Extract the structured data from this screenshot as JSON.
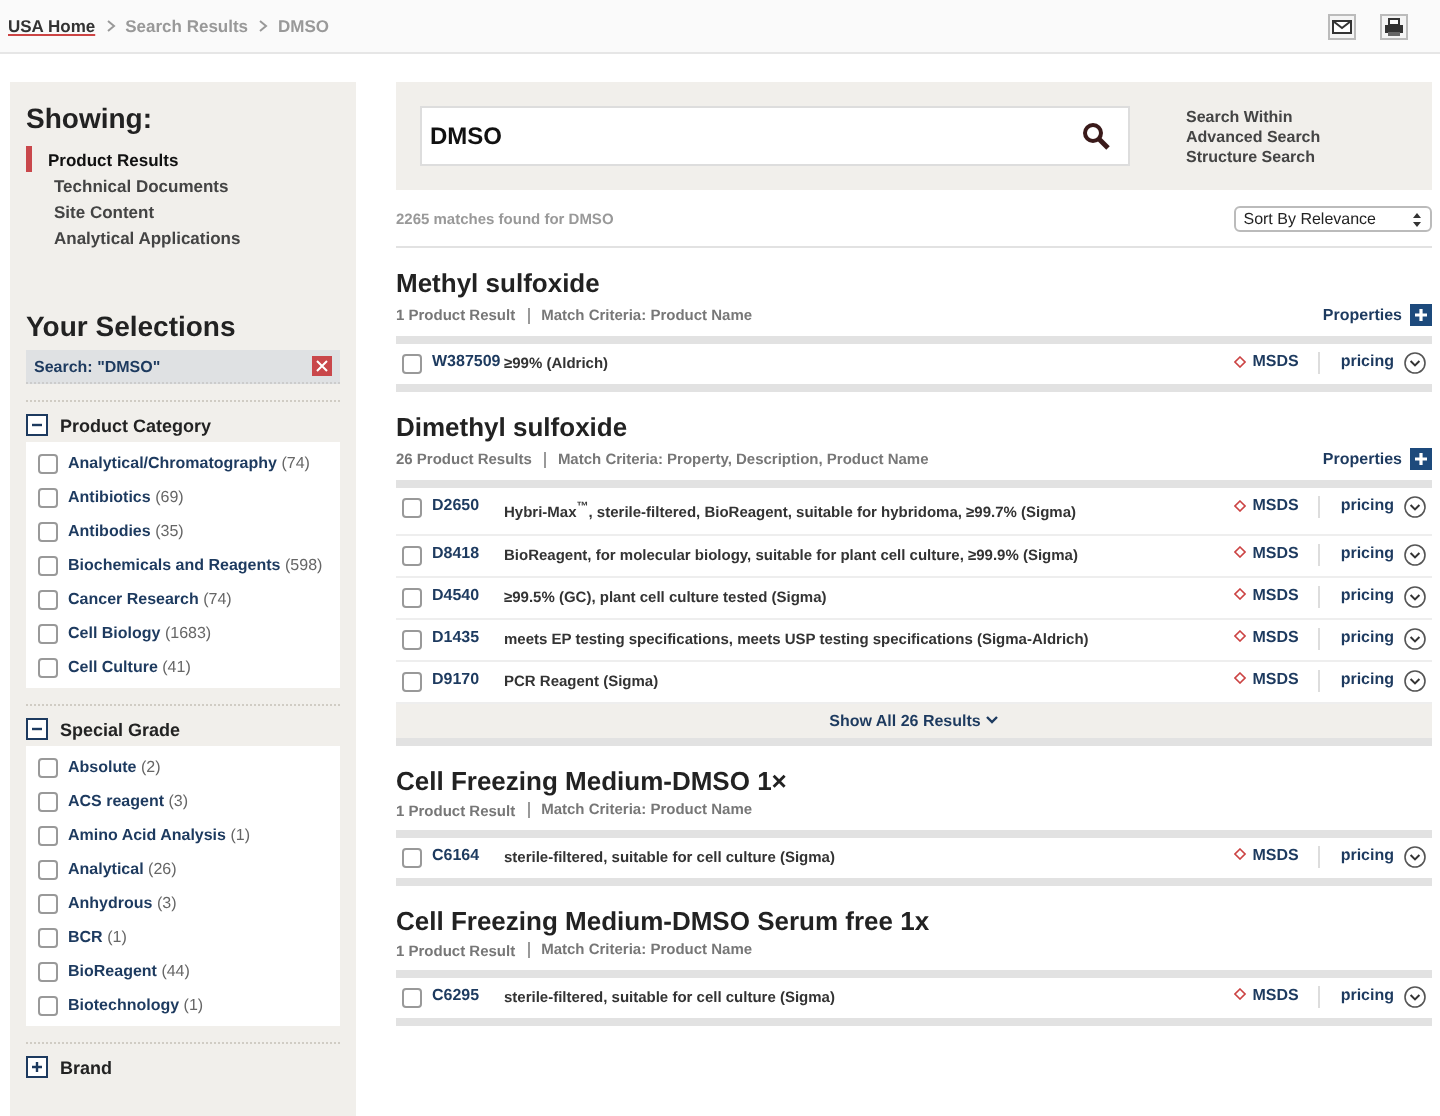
{
  "breadcrumb": [
    {
      "label": "USA Home",
      "kind": "home"
    },
    {
      "label": "Search Results",
      "kind": "crumb"
    },
    {
      "label": "DMSO",
      "kind": "crumb"
    }
  ],
  "sidebar": {
    "showing": {
      "title": "Showing:",
      "items": [
        {
          "label": "Product Results",
          "selected": true
        },
        {
          "label": "Technical Documents",
          "selected": false
        },
        {
          "label": "Site Content",
          "selected": false
        },
        {
          "label": "Analytical Applications",
          "selected": false
        }
      ]
    },
    "selections": {
      "title": "Your Selections",
      "chips": [
        {
          "label": "Search: \"DMSO\""
        }
      ]
    },
    "facets": [
      {
        "title": "Product Category",
        "expanded": true,
        "options": [
          {
            "label": "Analytical/Chromatography",
            "count": "(74)",
            "checked": false
          },
          {
            "label": "Antibiotics",
            "count": "(69)",
            "checked": false
          },
          {
            "label": "Antibodies",
            "count": "(35)",
            "checked": false
          },
          {
            "label": "Biochemicals and Reagents",
            "count": "(598)",
            "checked": false
          },
          {
            "label": "Cancer Research",
            "count": "(74)",
            "checked": false
          },
          {
            "label": "Cell Biology",
            "count": "(1683)",
            "checked": false
          },
          {
            "label": "Cell Culture",
            "count": "(41)",
            "checked": false
          }
        ]
      },
      {
        "title": "Special Grade",
        "expanded": true,
        "options": [
          {
            "label": "Absolute",
            "count": "(2)",
            "checked": false
          },
          {
            "label": "ACS reagent",
            "count": "(3)",
            "checked": false
          },
          {
            "label": "Amino Acid Analysis",
            "count": "(1)",
            "checked": false
          },
          {
            "label": "Analytical",
            "count": "(26)",
            "checked": false
          },
          {
            "label": "Anhydrous",
            "count": "(3)",
            "checked": false
          },
          {
            "label": "BCR",
            "count": "(1)",
            "checked": false
          },
          {
            "label": "BioReagent",
            "count": "(44)",
            "checked": false
          },
          {
            "label": "Biotechnology",
            "count": "(1)",
            "checked": false
          }
        ]
      },
      {
        "title": "Brand",
        "expanded": false
      }
    ]
  },
  "search": {
    "value": "DMSO",
    "links": [
      "Search Within",
      "Advanced Search",
      "Structure Search"
    ]
  },
  "result_count": "2265 matches found for DMSO",
  "sort": {
    "value": "Sort By Relevance"
  },
  "groups": [
    {
      "title": "Methyl sulfoxide",
      "result_count": "1 Product Result",
      "criteria": "Match Criteria: Product Name",
      "properties": "Properties",
      "products": [
        {
          "id": "W387509",
          "description": "≥99% (Aldrich)",
          "checked": false,
          "msds": "MSDS",
          "pricing": "pricing"
        }
      ]
    },
    {
      "title": "Dimethyl sulfoxide",
      "result_count": "26 Product Results",
      "criteria": "Match Criteria: Property, Description, Product Name",
      "properties": "Properties",
      "show_all": "Show All 26 Results",
      "products": [
        {
          "id": "D2650",
          "description": "Hybri-Max$^{™}$, sterile-filtered, BioReagent, suitable for hybridoma, ≥99.7% (Sigma)",
          "checked": false,
          "msds": "MSDS",
          "pricing": "pricing"
        },
        {
          "id": "D8418",
          "description": "BioReagent, for molecular biology, suitable for plant cell culture, ≥99.9% (Sigma)",
          "checked": false,
          "msds": "MSDS",
          "pricing": "pricing"
        },
        {
          "id": "D4540",
          "description": "≥99.5% (GC), plant cell culture tested (Sigma)",
          "checked": false,
          "msds": "MSDS",
          "pricing": "pricing"
        },
        {
          "id": "D1435",
          "description": "meets EP testing specifications, meets USP testing specifications (Sigma-Aldrich)",
          "checked": false,
          "msds": "MSDS",
          "pricing": "pricing"
        },
        {
          "id": "D9170",
          "description": "PCR Reagent (Sigma)",
          "checked": false,
          "msds": "MSDS",
          "pricing": "pricing"
        }
      ]
    },
    {
      "title": "Cell Freezing Medium-DMSO 1×",
      "result_count": "1 Product Result",
      "criteria": "Match Criteria: Product Name",
      "products": [
        {
          "id": "C6164",
          "description": "sterile-filtered, suitable for cell culture (Sigma)",
          "checked": false,
          "msds": "MSDS",
          "pricing": "pricing"
        }
      ]
    },
    {
      "title": "Cell Freezing Medium-DMSO Serum free 1x",
      "result_count": "1 Product Result",
      "criteria": "Match Criteria: Product Name",
      "products": [
        {
          "id": "C6295",
          "description": "sterile-filtered, suitable for cell culture (Sigma)",
          "checked": false,
          "msds": "MSDS",
          "pricing": "pricing"
        }
      ]
    }
  ]
}
